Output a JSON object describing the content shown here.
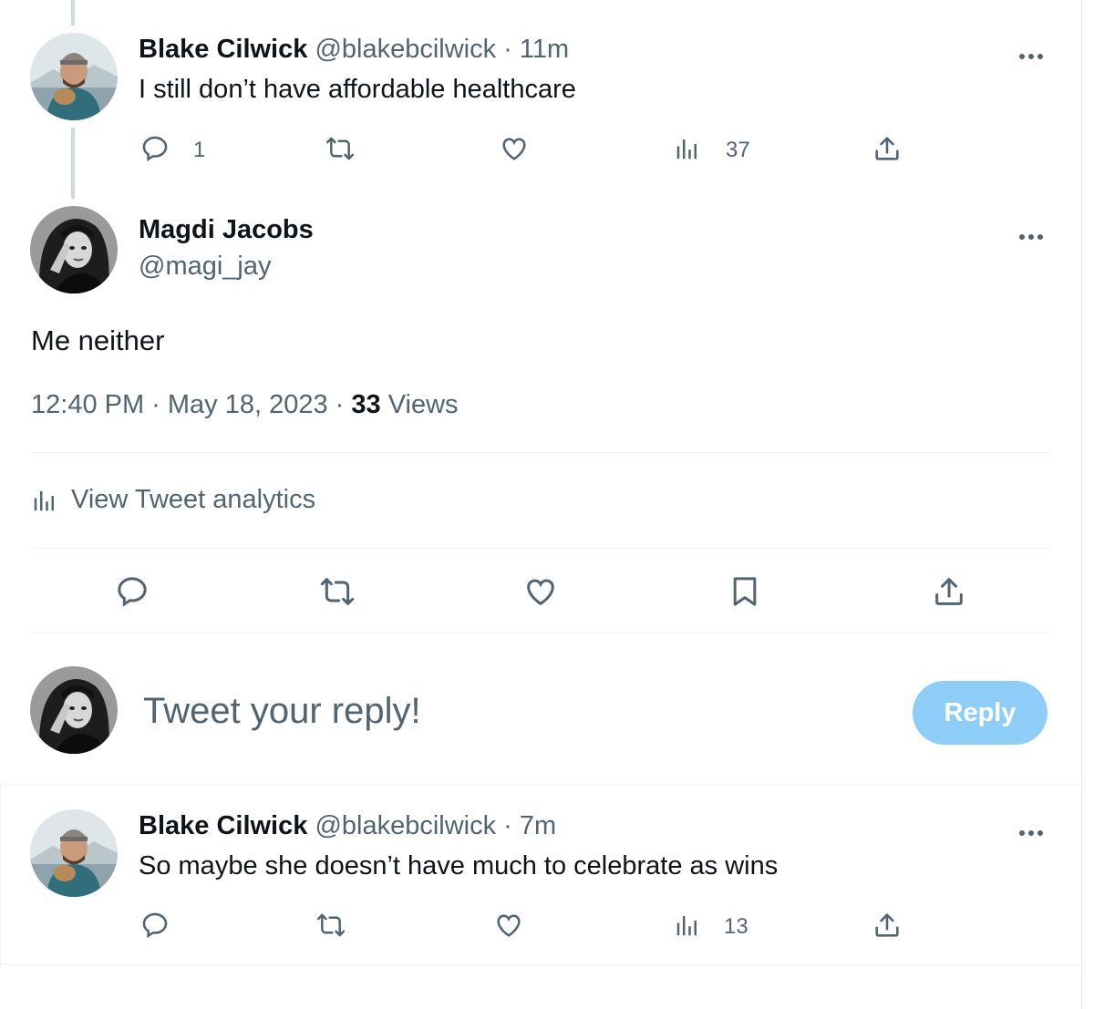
{
  "tweets": [
    {
      "name": "Blake Cilwick",
      "handle": "@blakebcilwick",
      "time": "· 11m",
      "text": "I still don’t have affordable healthcare",
      "replies": "1",
      "views": "37"
    },
    {
      "name": "Blake Cilwick",
      "handle": "@blakebcilwick",
      "time": "· 7m",
      "text": "So maybe she doesn’t have much to celebrate as wins",
      "views": "13"
    }
  ],
  "main": {
    "name": "Magdi Jacobs",
    "handle": "@magi_jay",
    "text": "Me neither",
    "timestamp": "12:40 PM · May 18, 2023 · ",
    "views_count": "33",
    "views_label": " Views",
    "analytics_label": "View Tweet analytics"
  },
  "composer": {
    "placeholder": "Tweet your reply!",
    "button_label": "Reply",
    "button_color": "#8ecdf8"
  },
  "colors": {
    "text": "#0f1419",
    "secondary": "#536471",
    "divider": "#eff3f4",
    "thread_line": "#cfd9de"
  },
  "icons": [
    "reply-icon",
    "retweet-icon",
    "like-icon",
    "views-icon",
    "share-icon",
    "bookmark-icon",
    "more-icon",
    "analytics-icon"
  ]
}
